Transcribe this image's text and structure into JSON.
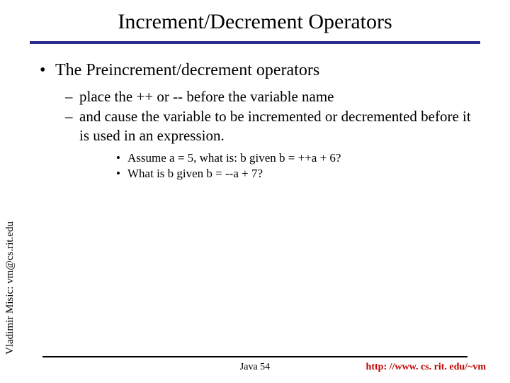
{
  "title": "Increment/Decrement Operators",
  "bullets": {
    "lvl1": "The Preincrement/decrement operators",
    "lvl2a": "place the ++ or -- before the variable name",
    "lvl2b": "and cause the variable to be incremented or decremented before it is used in an expression.",
    "lvl3a": "Assume a = 5,  what is: b given b = ++a + 6?",
    "lvl3b": "What is b given b = --a + 7?"
  },
  "glyphs": {
    "disc": "•",
    "dash": "–"
  },
  "author": "Vladimir Misic: vm@cs.rit.edu",
  "footer": {
    "center": "Java 54",
    "right": "http: //www. cs. rit. edu/~vm"
  }
}
